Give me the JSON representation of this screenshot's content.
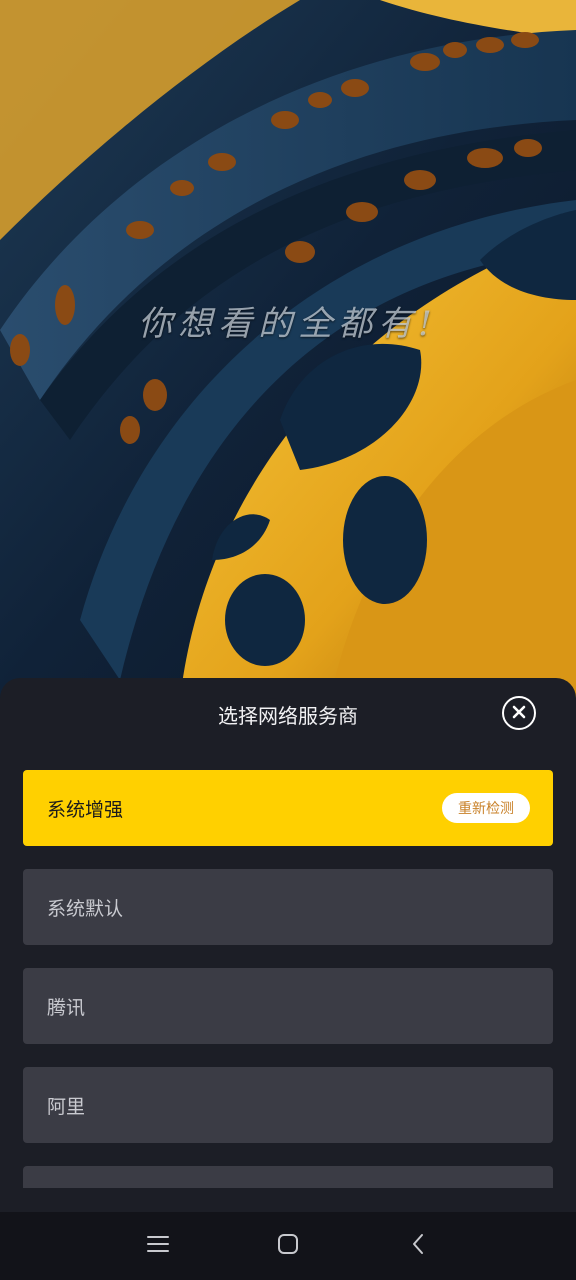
{
  "hero": {
    "slogan": "你想看的全都有!"
  },
  "sheet": {
    "title": "选择网络服务商",
    "close_icon": "close-circle-icon",
    "options": [
      {
        "label": "系统增强",
        "selected": true,
        "action_label": "重新检测"
      },
      {
        "label": "系统默认",
        "selected": false
      },
      {
        "label": "腾讯",
        "selected": false
      },
      {
        "label": "阿里",
        "selected": false
      },
      {
        "label": "",
        "selected": false
      }
    ]
  },
  "navbar": {
    "icons": [
      "menu-icon",
      "home-square-icon",
      "back-chevron-icon"
    ]
  },
  "colors": {
    "accent": "#ffd000",
    "sheet_bg": "#1c1e26",
    "option_bg": "#3b3c45",
    "recheck_text": "#c9822a"
  }
}
